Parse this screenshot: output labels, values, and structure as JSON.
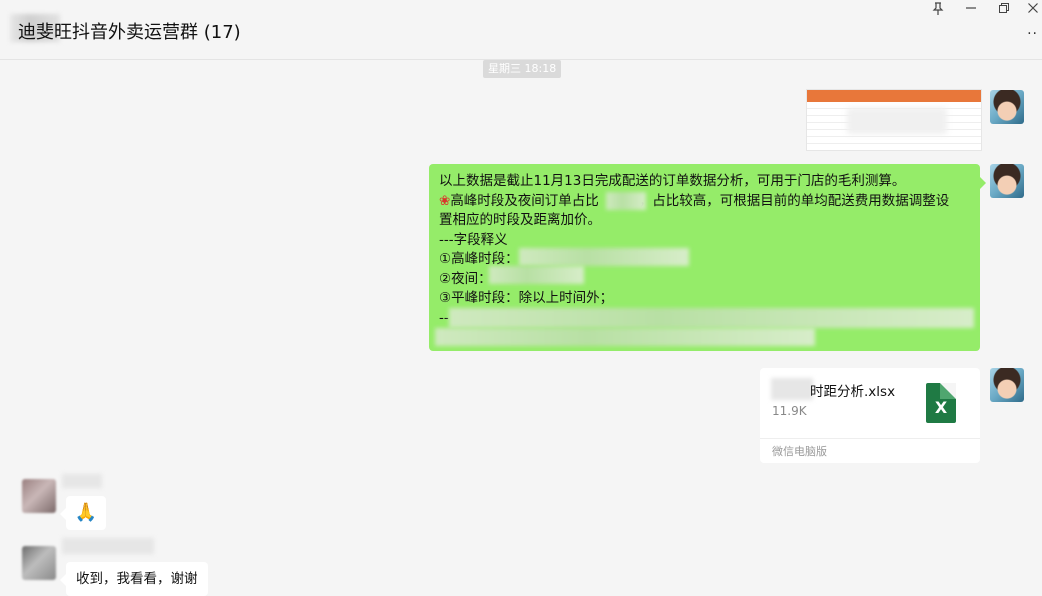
{
  "header": {
    "title": "迪斐旺抖音外卖运营群 (17)",
    "pin_icon": "pin-icon",
    "minimize_icon": "minimize-icon",
    "restore_icon": "restore-icon",
    "close_icon": "close-icon",
    "more_label": "··"
  },
  "timestamp": "星期三 18:18",
  "messages": {
    "text_lines": [
      "以上数据是截止11月13日完成配送的订单数据分析，可用于门店的毛利测算。",
      "高峰时段及夜间订单占比",
      "，占比较高，可根据目前的单均配送费用数据调整设",
      "置相应的时段及距离加价。",
      "---字段释义",
      "①高峰时段：",
      "②夜间：",
      "③平峰时段：除以上时间外；",
      "--"
    ],
    "flower_icon": "rose-icon",
    "file": {
      "name": "时距分析.xlsx",
      "size": "11.9K",
      "icon_label": "X",
      "source": "微信电脑版"
    },
    "reply_emoji": "🙏",
    "reply_text": "收到，我看看，谢谢"
  },
  "colors": {
    "sent_bubble": "#95ec69",
    "background": "#f5f5f5",
    "excel_green": "#1f7a44",
    "sheet_header": "#e8773a"
  }
}
